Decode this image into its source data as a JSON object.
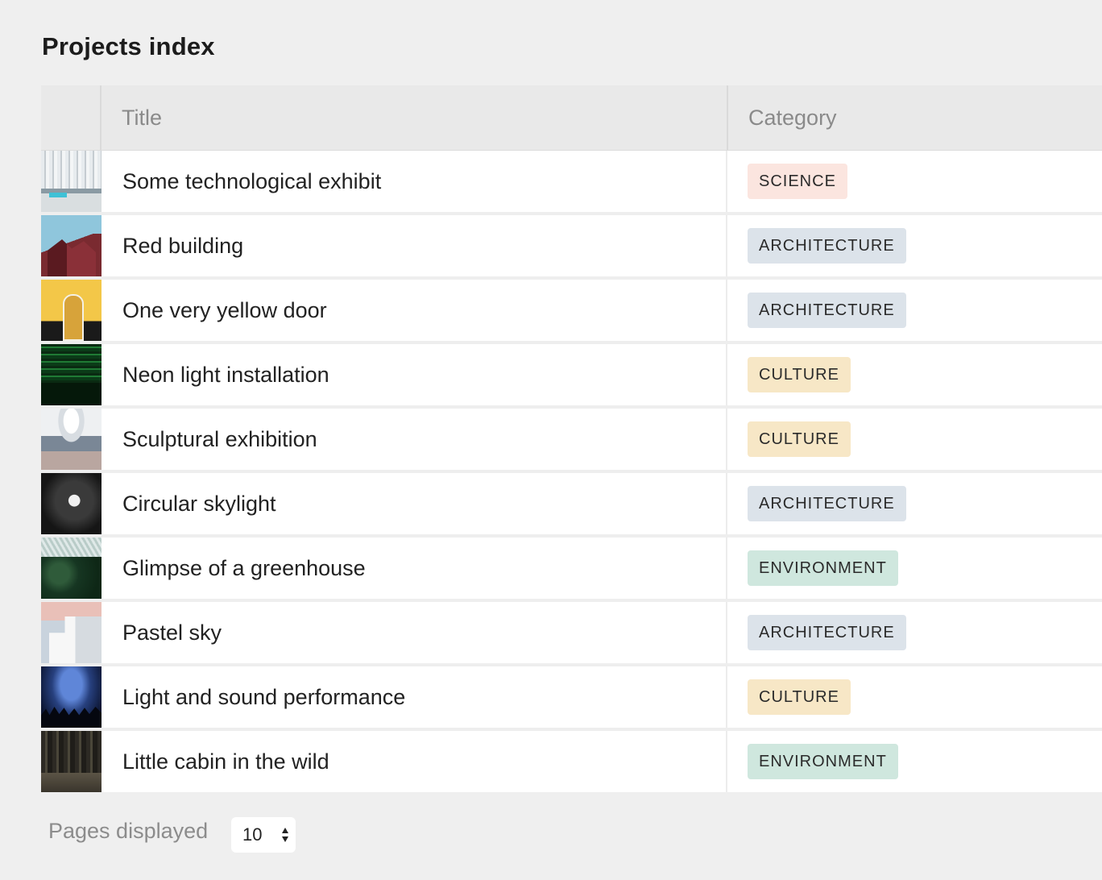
{
  "page": {
    "title": "Projects index"
  },
  "table": {
    "columns": {
      "title": "Title",
      "category": "Category"
    },
    "rows": [
      {
        "title": "Some technological exhibit",
        "category": "SCIENCE"
      },
      {
        "title": "Red building",
        "category": "ARCHITECTURE"
      },
      {
        "title": "One very yellow door",
        "category": "ARCHITECTURE"
      },
      {
        "title": "Neon light installation",
        "category": "CULTURE"
      },
      {
        "title": "Sculptural exhibition",
        "category": "CULTURE"
      },
      {
        "title": "Circular skylight",
        "category": "ARCHITECTURE"
      },
      {
        "title": "Glimpse of a greenhouse",
        "category": "ENVIRONMENT"
      },
      {
        "title": "Pastel sky",
        "category": "ARCHITECTURE"
      },
      {
        "title": "Light and sound performance",
        "category": "CULTURE"
      },
      {
        "title": "Little cabin in the wild",
        "category": "ENVIRONMENT"
      }
    ]
  },
  "category_colors": {
    "SCIENCE": "#fbe5df",
    "ARCHITECTURE": "#dce3ea",
    "CULTURE": "#f7e7c6",
    "ENVIRONMENT": "#cfe7de"
  },
  "footer": {
    "pages_label": "Pages displayed",
    "pages_value": "10"
  }
}
